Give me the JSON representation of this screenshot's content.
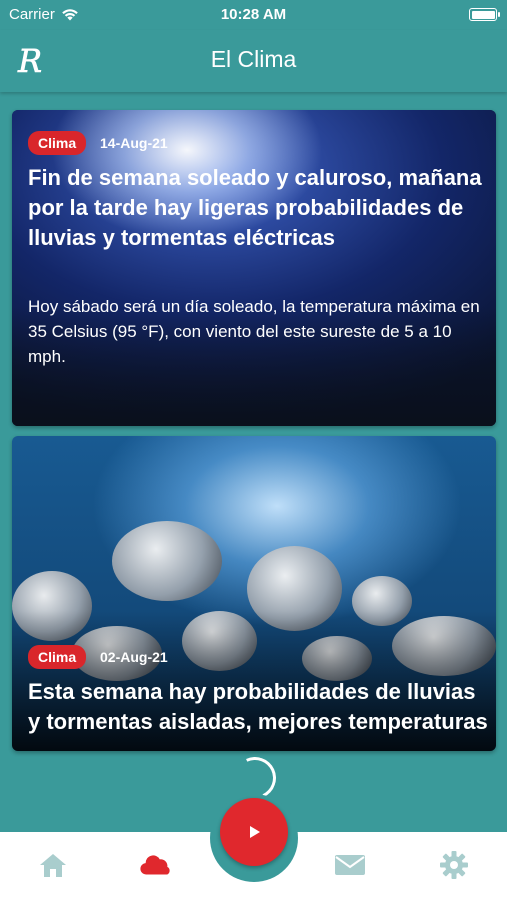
{
  "status_bar": {
    "carrier": "Carrier",
    "time": "10:28 AM"
  },
  "header": {
    "title": "El Clima",
    "logo_letter": "R"
  },
  "articles": [
    {
      "category": "Clima",
      "date": "14-Aug-21",
      "title": "Fin de semana soleado y caluroso, mañana por la tarde hay ligeras probabilidades de lluvias y tormentas eléctricas",
      "summary": "Hoy sábado será un día soleado, la temperatura máxima en 35 Celsius (95 °F), con viento del este sureste de 5 a 10 mph."
    },
    {
      "category": "Clima",
      "date": "02-Aug-21",
      "title": "Esta semana hay probabilidades de lluvias y tormentas aisladas, mejores temperaturas"
    }
  ],
  "tabbar": {
    "items": [
      {
        "icon": "home-icon"
      },
      {
        "icon": "cloud-icon",
        "active": true
      },
      {
        "icon": "play-icon"
      },
      {
        "icon": "mail-icon"
      },
      {
        "icon": "gear-icon"
      }
    ],
    "colors": {
      "active": "#e0282d",
      "inactive": "#a9cdcd"
    }
  },
  "colors": {
    "primary": "#3a9a9a",
    "badge": "#d9262b"
  }
}
